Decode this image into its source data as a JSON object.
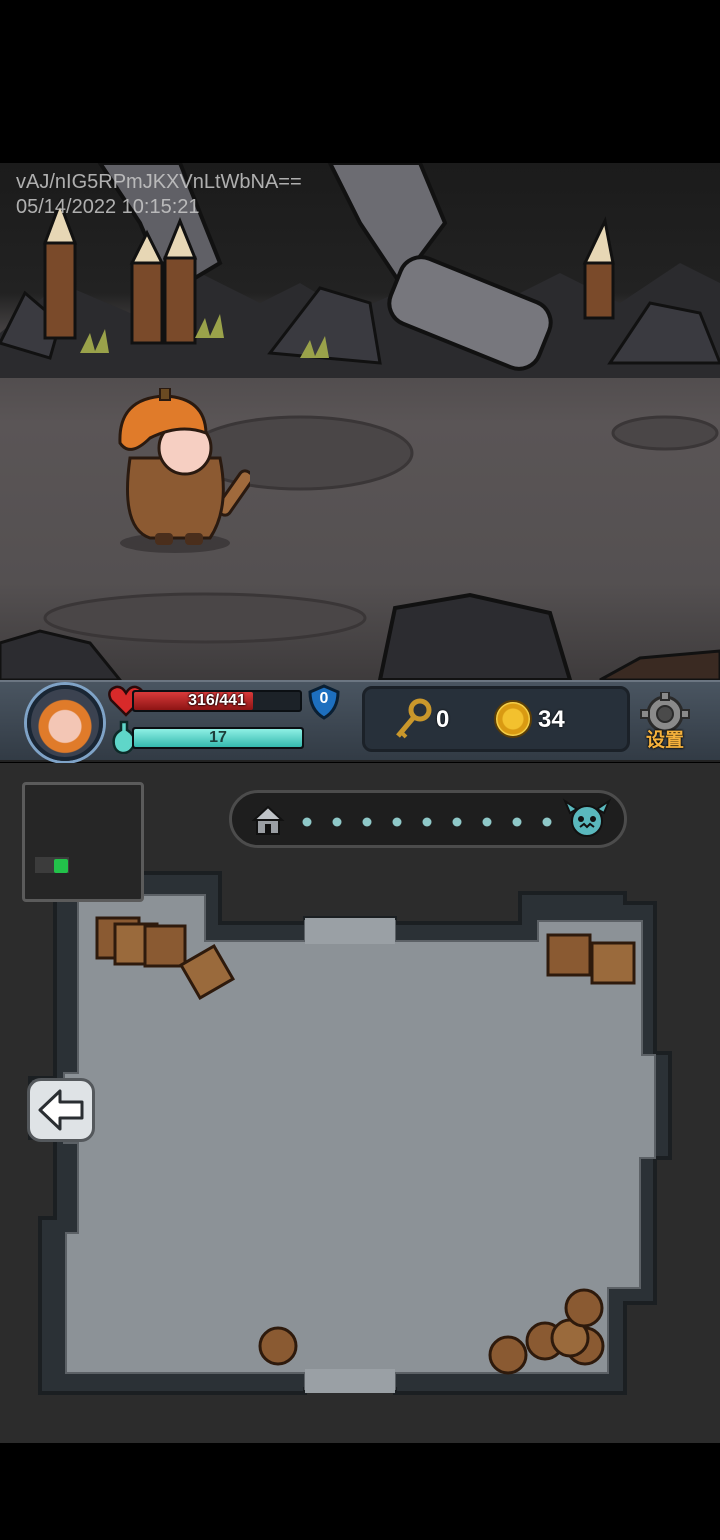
{
  "overlay": {
    "id_text": "vAJ/nIG5RPmJKXVnLtWbNA==",
    "timestamp": "05/14/2022 10:15:21"
  },
  "hud": {
    "hp_text": "316/441",
    "hp_current": 316,
    "hp_max": 441,
    "shield_value": "0",
    "mp_text": "17",
    "mp_fraction": 1.0,
    "keys": "0",
    "coins": "34",
    "settings_label": "设置"
  },
  "map": {
    "progress_nodes": 9,
    "start_icon": "hut-icon",
    "end_icon": "demon-boss-icon"
  },
  "colors": {
    "hp": "#c62828",
    "mp": "#5fd6c9",
    "settings_text": "#f6b23c",
    "minimap_player": "#22c24a"
  }
}
